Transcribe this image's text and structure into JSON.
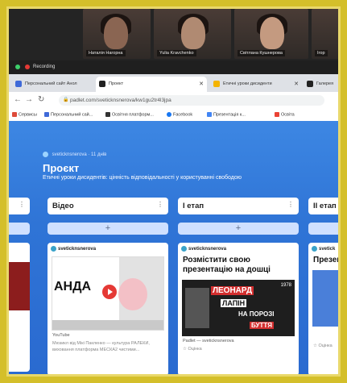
{
  "video_call": {
    "participants": [
      {
        "name": "Наталія Нагорна"
      },
      {
        "name": "Yulia Kravchenko"
      },
      {
        "name": "Світлана Кушнерова"
      },
      {
        "name": "Ігор"
      }
    ],
    "recording_label": "Recording"
  },
  "browser": {
    "tabs": [
      {
        "label": "Персональний сайт Анол",
        "icon": "site-icon",
        "color": "#3f6ad8"
      },
      {
        "label": "Проект",
        "icon": "padlet-icon",
        "color": "#222222"
      },
      {
        "label": "Етичні уроки дисиденти",
        "icon": "drive-icon",
        "color": "#f4b400"
      },
      {
        "label": "Галерея",
        "icon": "padlet-icon",
        "color": "#222222"
      }
    ],
    "url": "padlet.com/sveticknsnerova/kw1gu2tr4l3jpa",
    "bookmarks": [
      {
        "label": "Сервисы",
        "color": "#dd4b39"
      },
      {
        "label": "Персональний сай...",
        "color": "#3f6ad8"
      },
      {
        "label": "Освітня платформ...",
        "color": "#333333"
      },
      {
        "label": "Facebook",
        "color": "#1877f2"
      },
      {
        "label": "Презентація к...",
        "color": "#4285f4"
      },
      {
        "label": "Освіта",
        "color": "#ea4335"
      }
    ]
  },
  "board": {
    "author": "sveticknsnerova",
    "time": "11 днів",
    "title": "Проєкт",
    "subtitle": "Етичні уроки дисидентів: цінність відповідальності у користуванні свободою",
    "columns": [
      {
        "title": "Відео",
        "add_label": "+",
        "card": {
          "author": "sveticknsnerova",
          "thumb_text": "АНДА",
          "source": "YouTube",
          "caption": "Мюзикл від Мікі Пакленко — культура РАЛЕКИ, виховання платформа МЕСКА2 чистими..."
        }
      },
      {
        "title": "І етап",
        "add_label": "+",
        "card": {
          "author": "sveticknsnerova",
          "title": "Розмістити свою презентацію на дошці",
          "poster_line1": "ЛЕОНАРД",
          "poster_line2": "ЛАПІН",
          "poster_line3": "НА ПОРОЗІ",
          "poster_line4": "БУТТЯ",
          "poster_year": "1978",
          "source": "Padlet — sveticknsnerova",
          "footer": "Оцінка"
        }
      },
      {
        "title": "ІІ етап",
        "add_label": "+",
        "card": {
          "author": "svetick",
          "title": "Презен",
          "footer": "Оцінка"
        }
      }
    ]
  }
}
